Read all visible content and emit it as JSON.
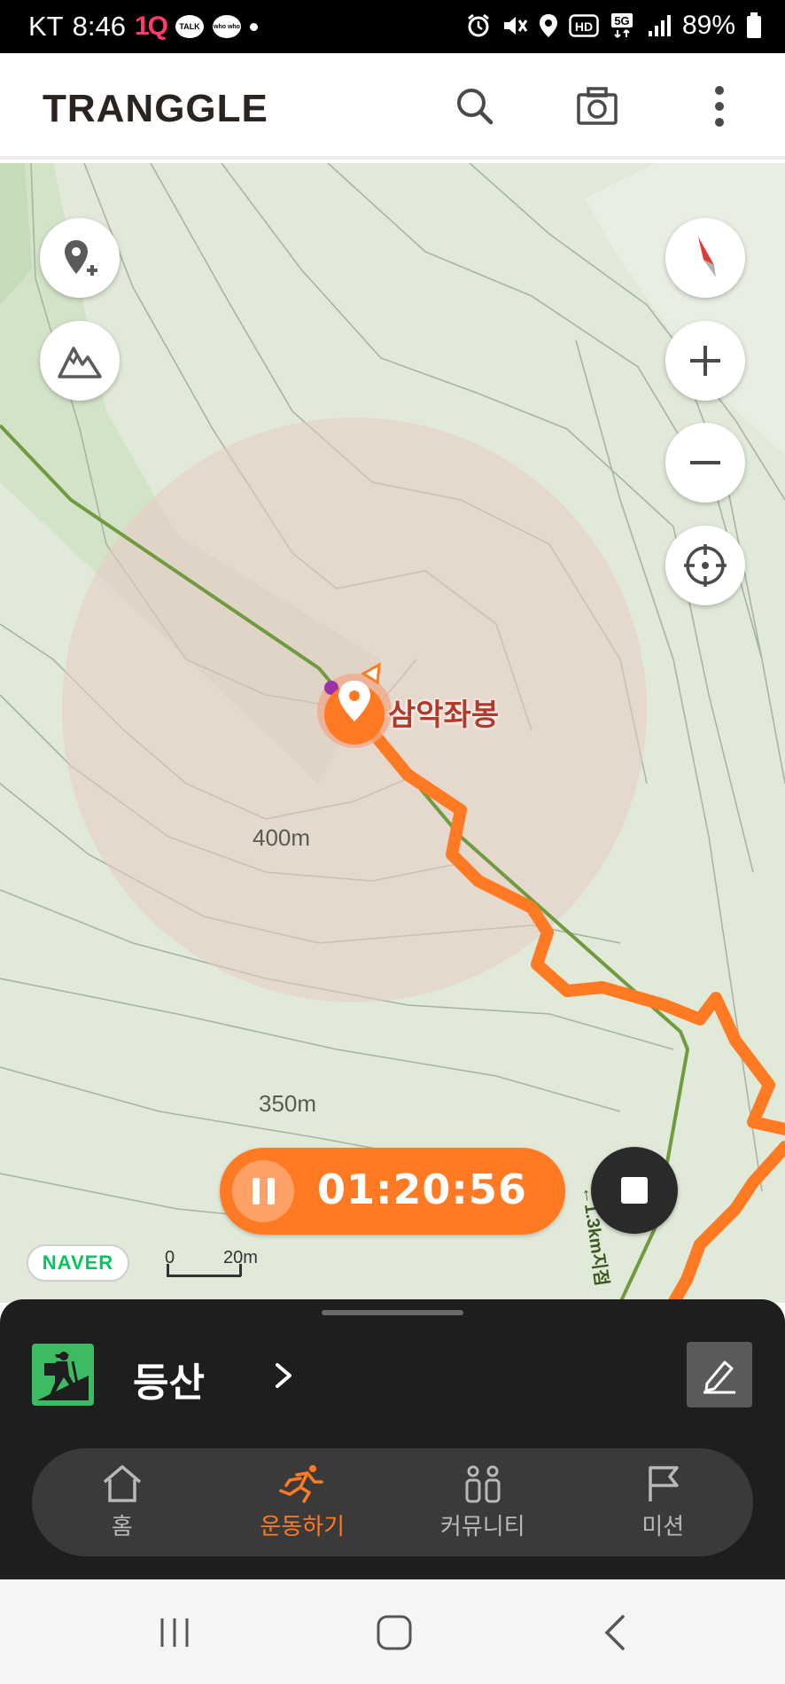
{
  "status_bar": {
    "carrier": "KT",
    "time": "8:46",
    "app_1q": "1Q",
    "talk_badge": "TALK",
    "whowho_badge": "who who",
    "battery": "89%",
    "icons": [
      "alarm-icon",
      "mute-vibrate-icon",
      "location-icon",
      "hd-icon",
      "5g-icon",
      "signal-icon",
      "battery-icon"
    ],
    "hd_label": "HD",
    "network_label": "5G"
  },
  "header": {
    "logo": "TRANGGLE",
    "icons": [
      "search-icon",
      "camera-icon",
      "more-vertical-icon"
    ]
  },
  "map": {
    "peak_name": "삼악좌봉",
    "contour_labels": [
      "400m",
      "350m"
    ],
    "trail_label": "←1.3km지점",
    "provider": "NAVER",
    "scale_start": "0",
    "scale_end": "20m",
    "track_color": "#ff7a22",
    "trail_color": "#6f9a3d"
  },
  "timer": {
    "elapsed": "01:20:56"
  },
  "activity": {
    "label": "등산",
    "icon": "hiking-icon"
  },
  "tabs": [
    {
      "label": "홈",
      "icon": "home-icon",
      "active": false
    },
    {
      "label": "운동하기",
      "icon": "running-icon",
      "active": true
    },
    {
      "label": "커뮤니티",
      "icon": "community-icon",
      "active": false
    },
    {
      "label": "미션",
      "icon": "flag-icon",
      "active": false
    }
  ],
  "colors": {
    "accent": "#ff7a22",
    "sheet_bg": "#1e1e1e",
    "activity_green": "#3dbb63"
  }
}
